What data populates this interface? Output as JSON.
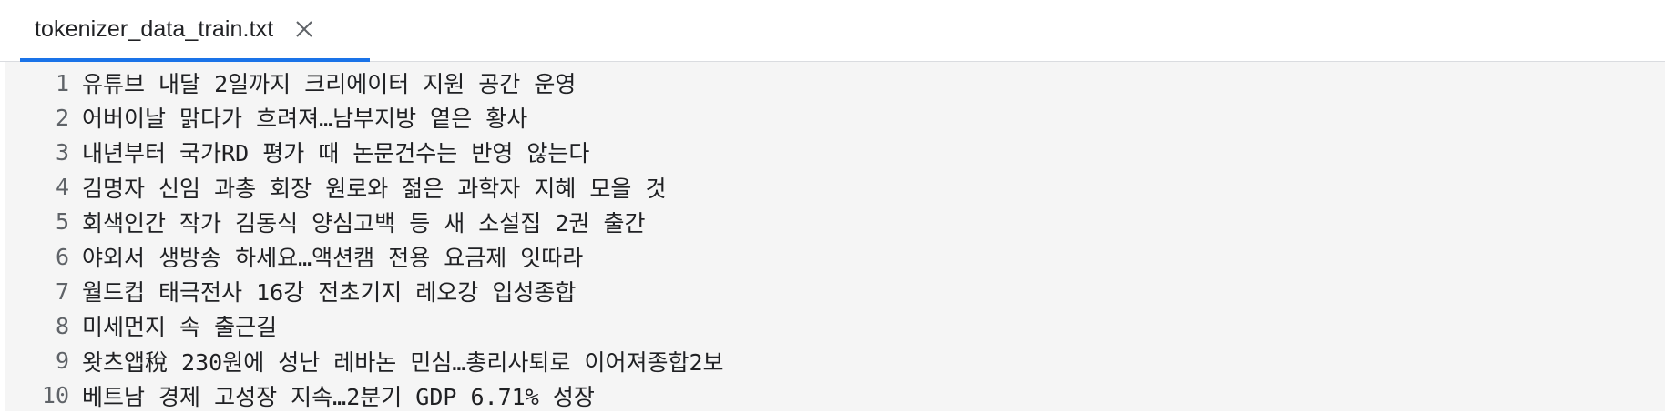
{
  "tab": {
    "title": "tokenizer_data_train.txt",
    "close_icon": "close-icon"
  },
  "colors": {
    "accent": "#1a73e8",
    "editor_background": "#f5f5f5",
    "text": "#202124",
    "line_number": "#5f6368"
  },
  "editor": {
    "lines": [
      {
        "number": "1",
        "text": "유튜브 내달 2일까지 크리에이터 지원 공간 운영"
      },
      {
        "number": "2",
        "text": "어버이날 맑다가 흐려져…남부지방 옅은 황사"
      },
      {
        "number": "3",
        "text": "내년부터 국가RD 평가 때 논문건수는 반영 않는다"
      },
      {
        "number": "4",
        "text": "김명자 신임 과총 회장 원로와 젊은 과학자 지혜 모을 것"
      },
      {
        "number": "5",
        "text": "회색인간 작가 김동식 양심고백 등 새 소설집 2권 출간"
      },
      {
        "number": "6",
        "text": "야외서 생방송 하세요…액션캠 전용 요금제 잇따라"
      },
      {
        "number": "7",
        "text": "월드컵 태극전사 16강 전초기지 레오강 입성종합"
      },
      {
        "number": "8",
        "text": "미세먼지 속 출근길"
      },
      {
        "number": "9",
        "text": "왓츠앱稅 230원에 성난 레바논 민심…총리사퇴로 이어져종합2보"
      },
      {
        "number": "10",
        "text": "베트남 경제 고성장 지속…2분기 GDP 6.71% 성장"
      }
    ]
  }
}
